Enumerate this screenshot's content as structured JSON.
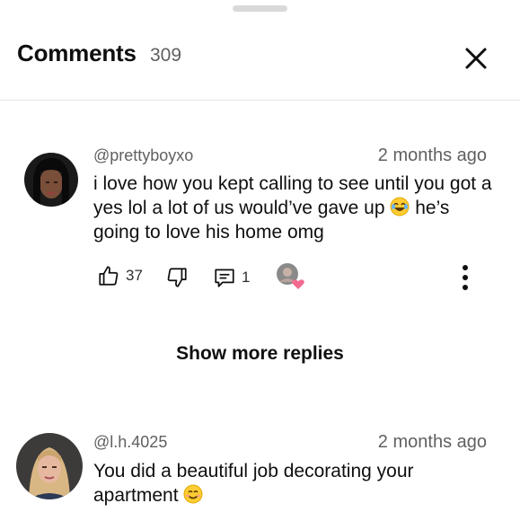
{
  "header": {
    "title": "Comments",
    "count": "309"
  },
  "comments": [
    {
      "handle": "@prettyboyxo",
      "time": "2 months ago",
      "text_parts": [
        "i love how you kept calling to see until you got a yes lol a lot of us would’ve gave up",
        "he’s going to love his home omg"
      ],
      "emoji": "😂",
      "likes": "37",
      "replies": "1",
      "icons": [
        "thumbs-up-icon",
        "thumbs-down-icon",
        "reply-icon",
        "creator-heart-icon",
        "more-vertical-icon"
      ]
    },
    {
      "handle": "@l.h.4025",
      "time": "2 months ago",
      "text_parts": [
        "You did a beautiful job decorating your apartment"
      ],
      "emoji": "😊"
    }
  ],
  "show_more_replies": "Show more replies",
  "colors": {
    "text_primary": "#0f0f0f",
    "text_secondary": "#606060",
    "divider": "#e5e5e5",
    "heart": "#f26b8f"
  }
}
